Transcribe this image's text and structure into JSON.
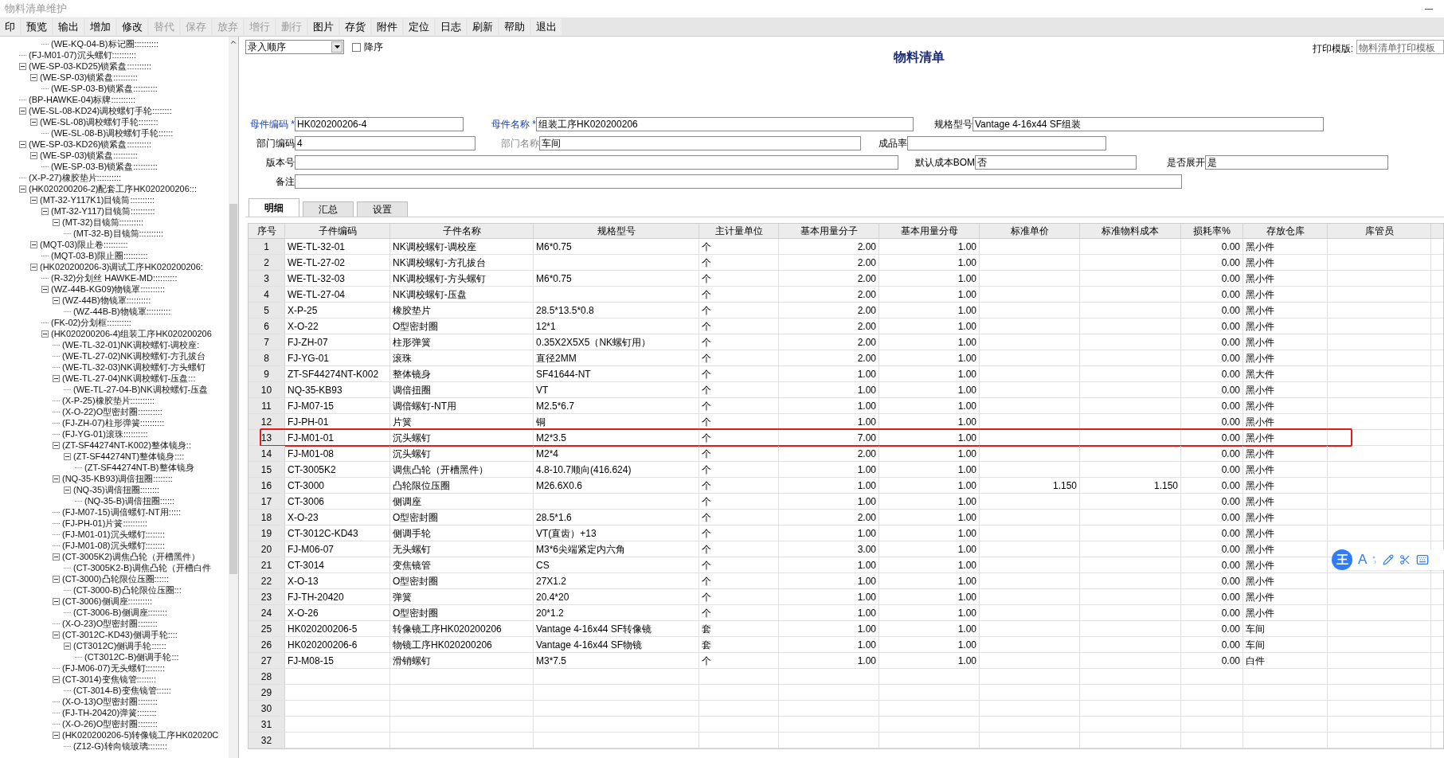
{
  "window": {
    "title": "物料清单维护"
  },
  "toolbar": [
    {
      "label": "印",
      "disabled": false
    },
    {
      "label": "预览",
      "disabled": false
    },
    {
      "label": "输出",
      "disabled": false
    },
    {
      "label": "增加",
      "disabled": false
    },
    {
      "label": "修改",
      "disabled": false
    },
    {
      "label": "替代",
      "disabled": true
    },
    {
      "label": "保存",
      "disabled": true
    },
    {
      "label": "放弃",
      "disabled": true
    },
    {
      "label": "增行",
      "disabled": true
    },
    {
      "label": "删行",
      "disabled": true
    },
    {
      "label": "图片",
      "disabled": false
    },
    {
      "label": "存货",
      "disabled": false
    },
    {
      "label": "附件",
      "disabled": false
    },
    {
      "label": "定位",
      "disabled": false
    },
    {
      "label": "日志",
      "disabled": false
    },
    {
      "label": "刷新",
      "disabled": false
    },
    {
      "label": "帮助",
      "disabled": false
    },
    {
      "label": "退出",
      "disabled": false
    }
  ],
  "tree": {
    "items": [
      {
        "children": [
          {
            "children": [
              {
                "label": "(WE-KQ-04-B)标记圈::::::::::"
              }
            ]
          }
        ]
      },
      {
        "label": "(FJ-M01-07)沉头螺钉::::::::::"
      },
      {
        "label": "(WE-SP-03-KD25)锁紧盘::::::::::",
        "expanded": true,
        "children": [
          {
            "label": "(WE-SP-03)锁紧盘::::::::::",
            "expanded": true,
            "children": [
              {
                "label": "(WE-SP-03-B)锁紧盘::::::::::"
              }
            ]
          }
        ]
      },
      {
        "label": "(BP-HAWKE-04)标牌::::::::::"
      },
      {
        "label": "(WE-SL-08-KD24)调校螺钉手轮::::::::",
        "expanded": true,
        "children": [
          {
            "label": "(WE-SL-08)调校螺钉手轮::::::::",
            "expanded": true,
            "children": [
              {
                "label": "(WE-SL-08-B)调校螺钉手轮::::::"
              }
            ]
          }
        ]
      },
      {
        "label": "(WE-SP-03-KD26)锁紧盘::::::::::",
        "expanded": true,
        "children": [
          {
            "label": "(WE-SP-03)锁紧盘::::::::::",
            "expanded": true,
            "children": [
              {
                "label": "(WE-SP-03-B)锁紧盘::::::::::"
              }
            ]
          }
        ]
      },
      {
        "label": "(X-P-27)橡胶垫片::::::::::"
      },
      {
        "label": "(HK020200206-2)配套工序HK020200206:::",
        "expanded": true,
        "children": [
          {
            "label": "(MT-32-Y117K1)目镜筒::::::::::",
            "expanded": true,
            "children": [
              {
                "label": "(MT-32-Y117)目镜筒::::::::::",
                "expanded": true,
                "children": [
                  {
                    "label": "(MT-32)目镜筒::::::::::",
                    "expanded": true,
                    "children": [
                      {
                        "label": "(MT-32-B)目镜筒::::::::::"
                      }
                    ]
                  }
                ]
              }
            ]
          },
          {
            "label": "(MQT-03)限止卷::::::::::",
            "expanded": true,
            "children": [
              {
                "label": "(MQT-03-B)限止圈::::::::::"
              }
            ]
          },
          {
            "label": "(HK020200206-3)调试工序HK020200206:",
            "expanded": true,
            "children": [
              {
                "label": "(R-32)分划丝 HAWKE-MD::::::::::"
              },
              {
                "label": "(WZ-44B-KG09)物镜罩::::::::::",
                "expanded": true,
                "children": [
                  {
                    "label": "(WZ-44B)物镜罩::::::::::",
                    "expanded": true,
                    "children": [
                      {
                        "label": "(WZ-44B-B)物镜罩::::::::::"
                      }
                    ]
                  }
                ]
              },
              {
                "label": "(FK-02)分划框::::::::::"
              },
              {
                "label": "(HK020200206-4)组装工序HK020200206",
                "expanded": true,
                "children": [
                  {
                    "label": "(WE-TL-32-01)NK调校螺钉-调校座:"
                  },
                  {
                    "label": "(WE-TL-27-02)NK调校螺钉-方孔拔台"
                  },
                  {
                    "label": "(WE-TL-32-03)NK调校螺钉-方头螺钉"
                  },
                  {
                    "label": "(WE-TL-27-04)NK调校螺钉-压盘:::",
                    "expanded": true,
                    "children": [
                      {
                        "label": "(WE-TL-27-04-B)NK调校螺钉-压盘"
                      }
                    ]
                  },
                  {
                    "label": "(X-P-25)橡胶垫片::::::::::"
                  },
                  {
                    "label": "(X-O-22)O型密封圈::::::::::"
                  },
                  {
                    "label": "(FJ-ZH-07)柱形弹簧::::::::::"
                  },
                  {
                    "label": "(FJ-YG-01)滚珠::::::::::"
                  },
                  {
                    "label": "(ZT-SF44274NT-K002)整体镜身::",
                    "expanded": true,
                    "children": [
                      {
                        "label": "(ZT-SF44274NT)整体镜身::::",
                        "expanded": true,
                        "children": [
                          {
                            "label": "(ZT-SF44274NT-B)整体镜身"
                          }
                        ]
                      }
                    ]
                  },
                  {
                    "label": "(NQ-35-KB93)调倍扭圈::::::::",
                    "expanded": true,
                    "children": [
                      {
                        "label": "(NQ-35)调倍扭圈::::::::",
                        "expanded": true,
                        "children": [
                          {
                            "label": "(NQ-35-B)调倍扭圈::::::"
                          }
                        ]
                      }
                    ]
                  },
                  {
                    "label": "(FJ-M07-15)调倍螺钉-NT用:::::"
                  },
                  {
                    "label": "(FJ-PH-01)片簧::::::::::"
                  },
                  {
                    "label": "(FJ-M01-01)沉头螺钉::::::::"
                  },
                  {
                    "label": "(FJ-M01-08)沉头螺钉::::::::"
                  },
                  {
                    "label": "(CT-3005K2)调焦凸轮（开槽黑件）",
                    "expanded": true,
                    "children": [
                      {
                        "label": "(CT-3005K2-B)调焦凸轮（开槽白件"
                      }
                    ]
                  },
                  {
                    "label": "(CT-3000)凸轮限位压圈::::::",
                    "expanded": true,
                    "children": [
                      {
                        "label": "(CT-3000-B)凸轮限位压圈:::"
                      }
                    ]
                  },
                  {
                    "label": "(CT-3006)侧调座::::::::::",
                    "expanded": true,
                    "children": [
                      {
                        "label": "(CT-3006-B)侧调座::::::::"
                      }
                    ]
                  },
                  {
                    "label": "(X-O-23)O型密封圈::::::::"
                  },
                  {
                    "label": "(CT-3012C-KD43)侧调手轮::::",
                    "expanded": true,
                    "children": [
                      {
                        "label": "(CT3012C)侧调手轮::::::",
                        "expanded": true,
                        "children": [
                          {
                            "label": "(CT3012C-B)侧调手轮:::"
                          }
                        ]
                      }
                    ]
                  },
                  {
                    "label": "(FJ-M06-07)无头螺钉::::::::"
                  },
                  {
                    "label": "(CT-3014)变焦镜管::::::::",
                    "expanded": true,
                    "children": [
                      {
                        "label": "(CT-3014-B)变焦镜管::::::"
                      }
                    ]
                  },
                  {
                    "label": "(X-O-13)O型密封圈::::::::"
                  },
                  {
                    "label": "(FJ-TH-20420)弹簧::::::::"
                  },
                  {
                    "label": "(X-O-26)O型密封圈::::::::"
                  },
                  {
                    "label": "(HK020200206-5)转像镜工序HK02020C",
                    "expanded": true,
                    "children": [
                      {
                        "label": "(Z12-G)转向镜玻璃::::::::"
                      }
                    ]
                  }
                ]
              }
            ]
          }
        ]
      }
    ]
  },
  "sort": {
    "value": "录入顺序"
  },
  "descending": {
    "label": "降序",
    "checked": false
  },
  "report_title": "物料清单",
  "print_template": {
    "label": "打印模版:",
    "value": "物料清单打印模板"
  },
  "form": {
    "rows": [
      [
        {
          "label": "母件编码",
          "required": true,
          "required_mark": "*",
          "value": "HK020200206-4"
        },
        {
          "label": "母件名称",
          "required": true,
          "required_mark": "*",
          "value": "组装工序HK020200206"
        },
        {
          "label": "规格型号",
          "required": false,
          "value": "Vantage 4-16x44 SF组装"
        }
      ],
      [
        {
          "label": "部门编码",
          "required": false,
          "value": "4"
        },
        {
          "label": "部门名称",
          "required": false,
          "disabled": true,
          "value": "车间"
        },
        {
          "label": "成品率",
          "required": false
        }
      ],
      [
        {
          "label": "版本号",
          "required": false
        },
        {
          "label": "默认成本BOM",
          "required": false,
          "value": "否"
        },
        {
          "label": "是否展开",
          "required": false,
          "value": "是"
        }
      ],
      [
        {
          "label": "备注",
          "required": false
        }
      ]
    ]
  },
  "tabs": [
    {
      "label": "明细",
      "selected": true
    },
    {
      "label": "汇总",
      "selected": false
    },
    {
      "label": "设置",
      "selected": false
    }
  ],
  "table": {
    "columns": [
      "序号",
      "子件编码",
      "子件名称",
      "规格型号",
      "主计量单位",
      "基本用量分子",
      "基本用量分母",
      "标准单价",
      "标准物料成本",
      "损耗率%",
      "存放仓库",
      "库管员"
    ],
    "rows": [
      {
        "no": "1",
        "highlighted": false,
        "cells": [
          "WE-TL-32-01",
          "NK调校螺钉-调校座",
          "M6*0.75",
          "个",
          "2.00",
          "1.00",
          null,
          null,
          "0.00",
          "黑小件",
          null
        ]
      },
      {
        "no": "2",
        "highlighted": false,
        "cells": [
          "WE-TL-27-02",
          "NK调校螺钉-方孔拔台",
          null,
          "个",
          "2.00",
          "1.00",
          null,
          null,
          "0.00",
          "黑小件",
          null
        ]
      },
      {
        "no": "3",
        "highlighted": false,
        "cells": [
          "WE-TL-32-03",
          "NK调校螺钉-方头螺钉",
          "M6*0.75",
          "个",
          "2.00",
          "1.00",
          null,
          null,
          "0.00",
          "黑小件",
          null
        ]
      },
      {
        "no": "4",
        "highlighted": false,
        "cells": [
          "WE-TL-27-04",
          "NK调校螺钉-压盘",
          null,
          "个",
          "2.00",
          "1.00",
          null,
          null,
          "0.00",
          "黑小件",
          null
        ]
      },
      {
        "no": "5",
        "highlighted": false,
        "cells": [
          "X-P-25",
          "橡胶垫片",
          "28.5*13.5*0.8",
          "个",
          "2.00",
          "1.00",
          null,
          null,
          "0.00",
          "黑小件",
          null
        ]
      },
      {
        "no": "6",
        "highlighted": false,
        "cells": [
          "X-O-22",
          "O型密封圈",
          "12*1",
          "个",
          "2.00",
          "1.00",
          null,
          null,
          "0.00",
          "黑小件",
          null
        ]
      },
      {
        "no": "7",
        "highlighted": false,
        "cells": [
          "FJ-ZH-07",
          "柱形弹簧",
          "0.35X2X5X5（NK螺钉用）",
          "个",
          "2.00",
          "1.00",
          null,
          null,
          "0.00",
          "黑小件",
          null
        ]
      },
      {
        "no": "8",
        "highlighted": false,
        "cells": [
          "FJ-YG-01",
          "滚珠",
          "直径2MM",
          "个",
          "2.00",
          "1.00",
          null,
          null,
          "0.00",
          "黑小件",
          null
        ]
      },
      {
        "no": "9",
        "highlighted": false,
        "cells": [
          "ZT-SF44274NT-K002",
          "整体镜身",
          "SF41644-NT",
          "个",
          "1.00",
          "1.00",
          null,
          null,
          "0.00",
          "黑大件",
          null
        ]
      },
      {
        "no": "10",
        "highlighted": false,
        "cells": [
          "NQ-35-KB93",
          "调倍扭圈",
          "VT",
          "个",
          "1.00",
          "1.00",
          null,
          null,
          "0.00",
          "黑小件",
          null
        ]
      },
      {
        "no": "11",
        "highlighted": false,
        "cells": [
          "FJ-M07-15",
          "调倍螺钉-NT用",
          "M2.5*6.7",
          "个",
          "1.00",
          "1.00",
          null,
          null,
          "0.00",
          "黑小件",
          null
        ]
      },
      {
        "no": "12",
        "highlighted": false,
        "cells": [
          "FJ-PH-01",
          "片簧",
          "铜",
          "个",
          "1.00",
          "1.00",
          null,
          null,
          "0.00",
          "黑小件",
          null
        ]
      },
      {
        "no": "13",
        "highlighted": true,
        "cells": [
          "FJ-M01-01",
          "沉头螺钉",
          "M2*3.5",
          "个",
          "7.00",
          "1.00",
          null,
          null,
          "0.00",
          "黑小件",
          null
        ]
      },
      {
        "no": "14",
        "highlighted": false,
        "cells": [
          "FJ-M01-08",
          "沉头螺钉",
          "M2*4",
          "个",
          "2.00",
          "1.00",
          null,
          null,
          "0.00",
          "黑小件",
          null
        ]
      },
      {
        "no": "15",
        "highlighted": false,
        "cells": [
          "CT-3005K2",
          "调焦凸轮（开槽黑件）",
          "4.8-10.7顺向(416.624)",
          "个",
          "1.00",
          "1.00",
          null,
          null,
          "0.00",
          "黑小件",
          null
        ]
      },
      {
        "no": "16",
        "highlighted": false,
        "cells": [
          "CT-3000",
          "凸轮限位压圈",
          "M26.6X0.6",
          "个",
          "1.00",
          "1.00",
          "1.150",
          "1.150",
          "0.00",
          "黑小件",
          null
        ]
      },
      {
        "no": "17",
        "highlighted": false,
        "cells": [
          "CT-3006",
          "侧调座",
          null,
          "个",
          "1.00",
          "1.00",
          null,
          null,
          "0.00",
          "黑小件",
          null
        ]
      },
      {
        "no": "18",
        "highlighted": false,
        "cells": [
          "X-O-23",
          "O型密封圈",
          "28.5*1.6",
          "个",
          "2.00",
          "1.00",
          null,
          null,
          "0.00",
          "黑小件",
          null
        ]
      },
      {
        "no": "19",
        "highlighted": false,
        "cells": [
          "CT-3012C-KD43",
          "侧调手轮",
          "VT(直齿）+13",
          "个",
          "1.00",
          "1.00",
          null,
          null,
          "0.00",
          "黑小件",
          null
        ]
      },
      {
        "no": "20",
        "highlighted": false,
        "cells": [
          "FJ-M06-07",
          "无头螺钉",
          "M3*6尖端紧定内六角",
          "个",
          "3.00",
          "1.00",
          null,
          null,
          "0.00",
          "黑小件",
          null
        ]
      },
      {
        "no": "21",
        "highlighted": false,
        "cells": [
          "CT-3014",
          "变焦镜管",
          "CS",
          "个",
          "1.00",
          "1.00",
          null,
          null,
          "0.00",
          "黑小件",
          null
        ]
      },
      {
        "no": "22",
        "highlighted": false,
        "cells": [
          "X-O-13",
          "O型密封圈",
          "27X1.2",
          "个",
          "1.00",
          "1.00",
          null,
          null,
          "0.00",
          "黑小件",
          null
        ]
      },
      {
        "no": "23",
        "highlighted": false,
        "cells": [
          "FJ-TH-20420",
          "弹簧",
          "20.4*20",
          "个",
          "1.00",
          "1.00",
          null,
          null,
          "0.00",
          "黑小件",
          null
        ]
      },
      {
        "no": "24",
        "highlighted": false,
        "cells": [
          "X-O-26",
          "O型密封圈",
          "20*1.2",
          "个",
          "1.00",
          "1.00",
          null,
          null,
          "0.00",
          "黑小件",
          null
        ]
      },
      {
        "no": "25",
        "highlighted": false,
        "cells": [
          "HK020200206-5",
          "转像镜工序HK020200206",
          "Vantage 4-16x44 SF转像镜",
          "套",
          "1.00",
          "1.00",
          null,
          null,
          "0.00",
          "车间",
          null
        ]
      },
      {
        "no": "26",
        "highlighted": false,
        "cells": [
          "HK020200206-6",
          "物镜工序HK020200206",
          "Vantage 4-16x44 SF物镜",
          "套",
          "1.00",
          "1.00",
          null,
          null,
          "0.00",
          "车间",
          null
        ]
      },
      {
        "no": "27",
        "highlighted": false,
        "cells": [
          "FJ-M08-15",
          "滑销螺钉",
          "M3*7.5",
          "个",
          "1.00",
          "1.00",
          null,
          null,
          "0.00",
          "白件",
          null
        ]
      },
      {
        "no": "28",
        "highlighted": false
      },
      {
        "no": "29",
        "highlighted": false
      },
      {
        "no": "30",
        "highlighted": false
      },
      {
        "no": "31",
        "highlighted": false
      },
      {
        "no": "32",
        "highlighted": false
      }
    ]
  },
  "ime_toolbar": {
    "logo": "王",
    "letter": "A"
  }
}
